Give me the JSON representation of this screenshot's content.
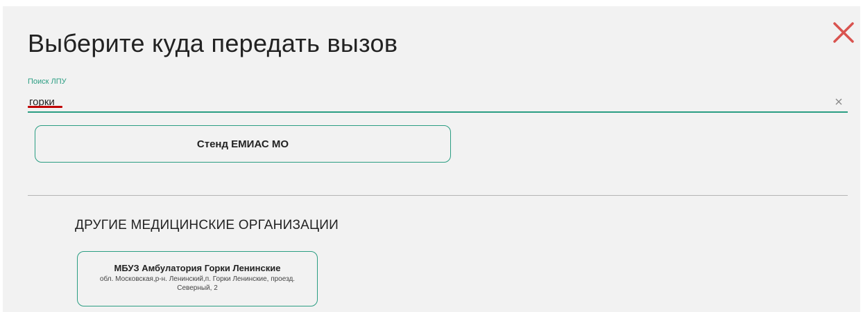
{
  "dialog": {
    "title": "Выберите куда передать вызов",
    "close_icon": "close-icon",
    "close_color": "#d9534f"
  },
  "search": {
    "label": "Поиск ЛПУ",
    "value": "горки",
    "clear_icon": "clear-icon",
    "accent_color": "#2a9d82"
  },
  "stand_button": {
    "label": "Стенд ЕМИАС МО"
  },
  "other_orgs": {
    "section_title": "ДРУГИЕ МЕДИЦИНСКИЕ ОРГАНИЗАЦИИ",
    "items": [
      {
        "name": "МБУЗ Амбулатория Горки Ленинские",
        "address": "обл. Московская,р-н. Ленинский,п. Горки Ленинские, проезд. Северный, 2"
      }
    ]
  }
}
